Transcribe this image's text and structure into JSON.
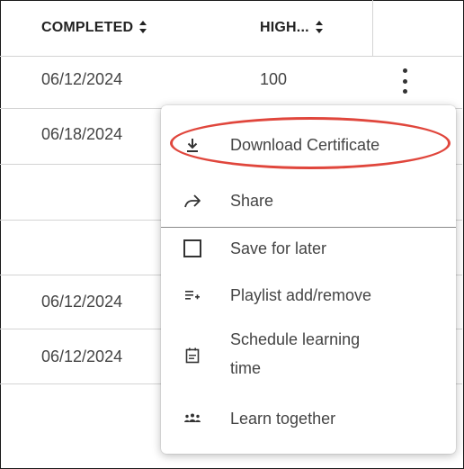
{
  "table": {
    "headers": {
      "completed": "COMPLETED",
      "high": "HIGH...",
      "sort_glyph": "▲▼"
    },
    "rows": [
      {
        "completed": "06/12/2024",
        "high": "100"
      },
      {
        "completed": "06/18/2024",
        "high": ""
      },
      {
        "completed": "",
        "high": ""
      },
      {
        "completed": "",
        "high": ""
      },
      {
        "completed": "06/12/2024",
        "high": ""
      },
      {
        "completed": "06/12/2024",
        "high": ""
      }
    ]
  },
  "menu": {
    "items": [
      {
        "label": "Download Certificate",
        "icon": "download-icon"
      },
      {
        "label": "Share",
        "icon": "share-icon"
      },
      {
        "label": "Save for later",
        "icon": "checkbox-icon"
      },
      {
        "label": "Playlist add/remove",
        "icon": "playlist-add-icon"
      },
      {
        "label": "Schedule learning",
        "label2": "time",
        "icon": "calendar-icon"
      },
      {
        "label": "Learn together",
        "icon": "group-icon"
      }
    ]
  },
  "colors": {
    "annotation": "#e0463c",
    "border": "#d4d4d4",
    "text": "#444444"
  }
}
